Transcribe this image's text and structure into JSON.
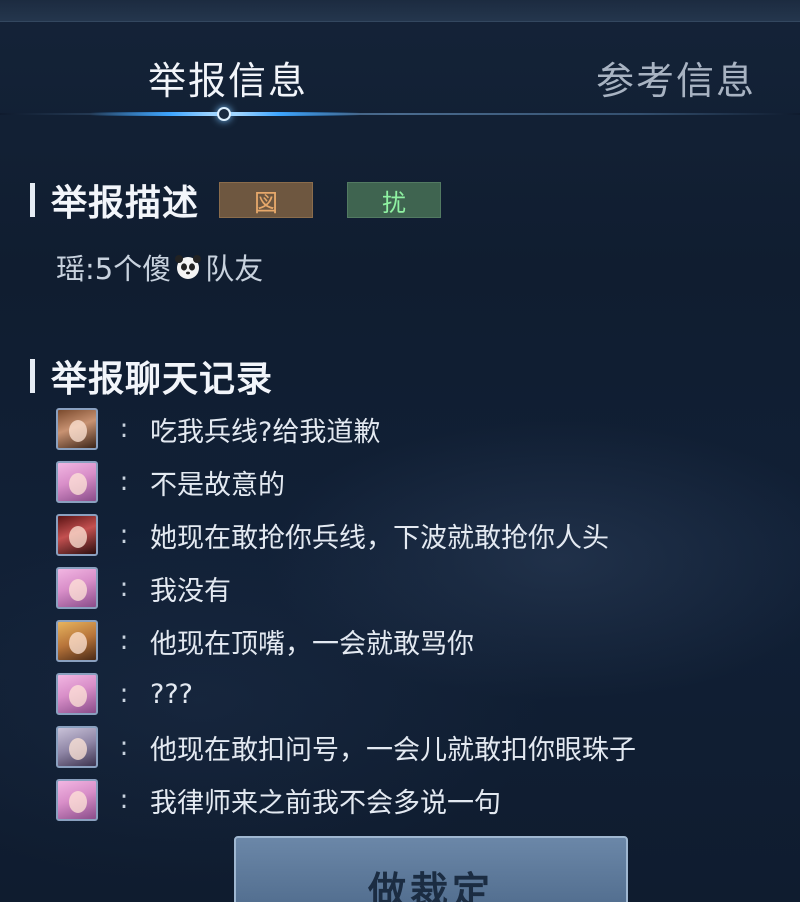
{
  "tabs": {
    "active": "举报信息",
    "inactive": "参考信息"
  },
  "report": {
    "title": "举报描述",
    "tag_orange": "図",
    "tag_green": "扰",
    "desc_prefix": "瑶:5个傻",
    "desc_suffix": "队友"
  },
  "chat": {
    "title": "举报聊天记录",
    "colon": ":",
    "messages": [
      {
        "avatar": "avatar-brown-hair",
        "text": "吃我兵线?给我道歉"
      },
      {
        "avatar": "avatar-pink-hair",
        "text": "不是故意的"
      },
      {
        "avatar": "avatar-red-hair",
        "text": "她现在敢抢你兵线，下波就敢抢你人头"
      },
      {
        "avatar": "avatar-pink-hair",
        "text": "我没有"
      },
      {
        "avatar": "avatar-gold-hair",
        "text": "他现在顶嘴，一会就敢骂你"
      },
      {
        "avatar": "avatar-pink-hair",
        "text": "???"
      },
      {
        "avatar": "avatar-gray-hair",
        "text": "他现在敢扣问号，一会儿就敢扣你眼珠子"
      },
      {
        "avatar": "avatar-pink-hair",
        "text": "我律师来之前我不会多说一句"
      }
    ]
  },
  "actions": {
    "verdict_label": "做裁定"
  },
  "colors": {
    "background": "#0f1b2e",
    "accent_blue": "#3da5ff",
    "tag_orange": "#6e5740",
    "tag_green": "#3f6450"
  }
}
